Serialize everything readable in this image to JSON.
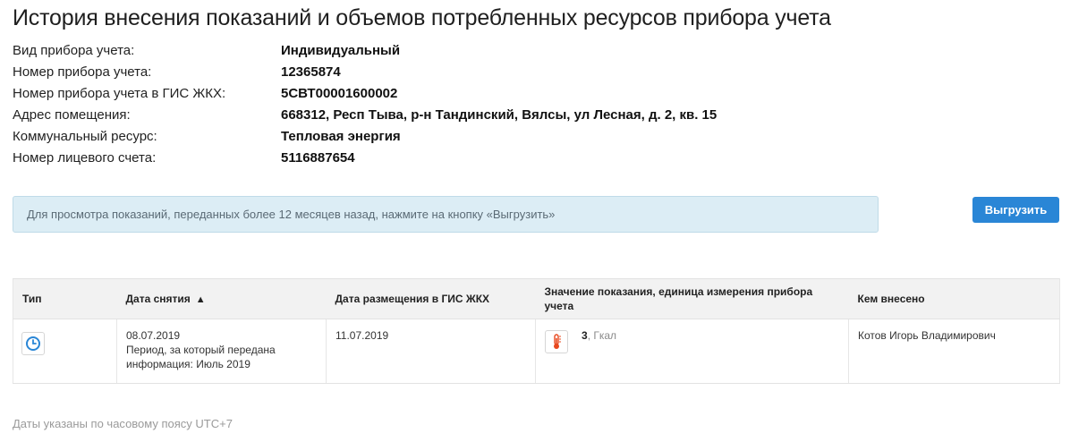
{
  "title": "История внесения показаний и объемов потребленных ресурсов прибора учета",
  "info": [
    {
      "label": "Вид прибора учета:",
      "value": "Индивидуальный"
    },
    {
      "label": "Номер прибора учета:",
      "value": "12365874"
    },
    {
      "label": "Номер прибора учета в ГИС ЖКХ:",
      "value": "5СВТ00001600002"
    },
    {
      "label": "Адрес помещения:",
      "value": "668312, Респ Тыва, р-н Тандинский, Вялсы, ул Лесная, д. 2, кв. 15"
    },
    {
      "label": "Коммунальный ресурс:",
      "value": "Тепловая энергия"
    },
    {
      "label": "Номер лицевого счета:",
      "value": "5116887654"
    }
  ],
  "notice": "Для просмотра показаний, переданных более 12 месяцев назад, нажмите на кнопку «Выгрузить»",
  "export_button": "Выгрузить",
  "table": {
    "headers": {
      "type": "Тип",
      "date_taken": "Дата снятия",
      "date_posted": "Дата размещения в ГИС ЖКХ",
      "value": "Значение показания, единица измерения прибора учета",
      "entered_by": "Кем внесено"
    },
    "sort_indicator": "▲",
    "rows": [
      {
        "type_icon": "clock-icon",
        "date_taken": "08.07.2019",
        "period_note": "Период, за который передана информация: Июль 2019",
        "date_posted": "11.07.2019",
        "value_icon": "thermometer-icon",
        "value": "3",
        "unit": ", Гкал",
        "entered_by": "Котов Игорь Владимирович"
      }
    ]
  },
  "footnote": "Даты указаны по часовому поясу UTC+7",
  "colors": {
    "accent": "#2a86d6",
    "notice_bg": "#dcedf5",
    "thermometer": "#e8481e"
  }
}
